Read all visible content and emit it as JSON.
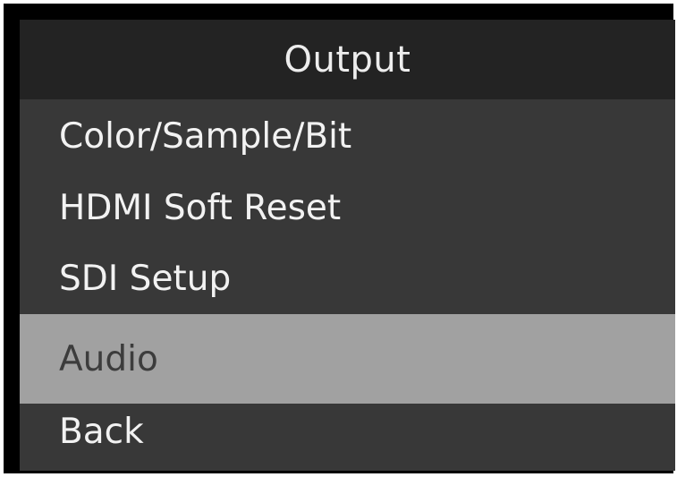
{
  "header": {
    "title": "Output"
  },
  "menu": {
    "items": [
      {
        "label": "Color/Sample/Bit",
        "selected": false
      },
      {
        "label": "HDMI Soft Reset",
        "selected": false
      },
      {
        "label": "SDI Setup",
        "selected": false
      },
      {
        "label": "Audio",
        "selected": true
      },
      {
        "label": "Back",
        "selected": false
      }
    ]
  },
  "colors": {
    "frame": "#000000",
    "header_bg": "#232323",
    "menu_bg": "#383838",
    "selected_bg": "#a1a1a1",
    "text": "#f2f2f2",
    "selected_text": "#3c3c3c"
  }
}
